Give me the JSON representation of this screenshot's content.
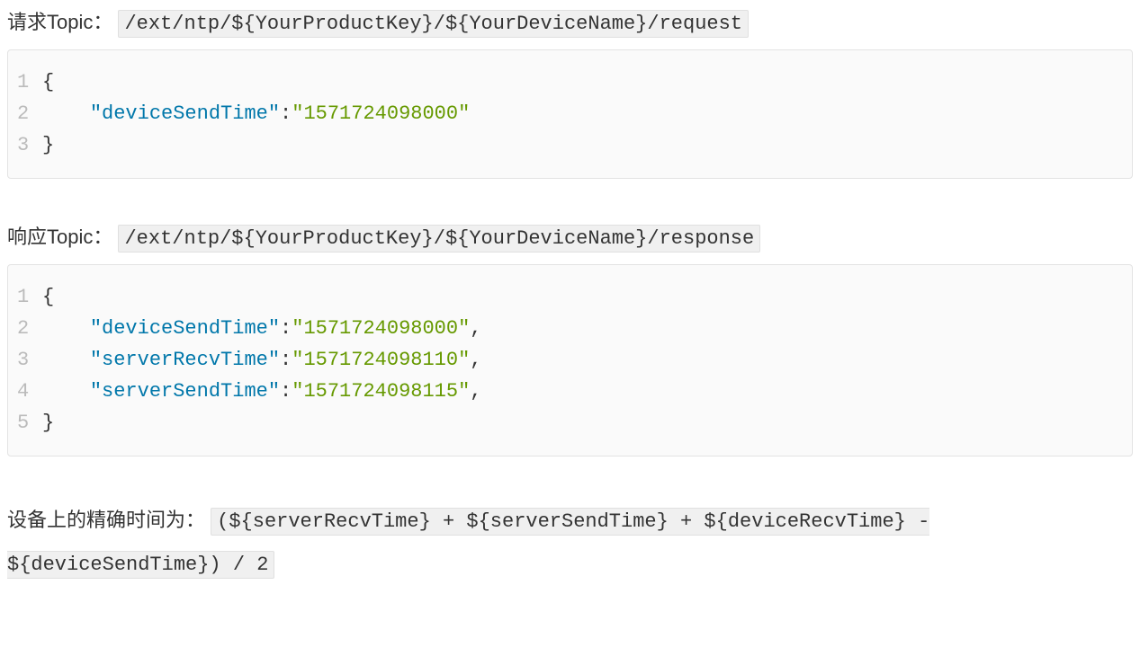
{
  "sections": {
    "request": {
      "label": "请求Topic：",
      "topic": "/ext/ntp/${YourProductKey}/${YourDeviceName}/request",
      "code": {
        "lines": [
          [
            {
              "t": "punc",
              "v": "{"
            }
          ],
          [
            {
              "t": "indent",
              "v": "    "
            },
            {
              "t": "key",
              "v": "\"deviceSendTime\""
            },
            {
              "t": "punc",
              "v": ":"
            },
            {
              "t": "str",
              "v": "\"1571724098000\""
            }
          ],
          [
            {
              "t": "punc",
              "v": "}"
            }
          ]
        ]
      }
    },
    "response": {
      "label": "响应Topic：",
      "topic": "/ext/ntp/${YourProductKey}/${YourDeviceName}/response",
      "code": {
        "lines": [
          [
            {
              "t": "punc",
              "v": "{"
            }
          ],
          [
            {
              "t": "indent",
              "v": "    "
            },
            {
              "t": "key",
              "v": "\"deviceSendTime\""
            },
            {
              "t": "punc",
              "v": ":"
            },
            {
              "t": "str",
              "v": "\"1571724098000\""
            },
            {
              "t": "punc",
              "v": ","
            }
          ],
          [
            {
              "t": "indent",
              "v": "    "
            },
            {
              "t": "key",
              "v": "\"serverRecvTime\""
            },
            {
              "t": "punc",
              "v": ":"
            },
            {
              "t": "str",
              "v": "\"1571724098110\""
            },
            {
              "t": "punc",
              "v": ","
            }
          ],
          [
            {
              "t": "indent",
              "v": "    "
            },
            {
              "t": "key",
              "v": "\"serverSendTime\""
            },
            {
              "t": "punc",
              "v": ":"
            },
            {
              "t": "str",
              "v": "\"1571724098115\""
            },
            {
              "t": "punc",
              "v": ","
            }
          ],
          [
            {
              "t": "punc",
              "v": "}"
            }
          ]
        ]
      }
    },
    "formula": {
      "label": "设备上的精确时间为：",
      "expr": "(${serverRecvTime} + ${serverSendTime} + ${deviceRecvTime} - ${deviceSendTime}) / 2"
    }
  }
}
